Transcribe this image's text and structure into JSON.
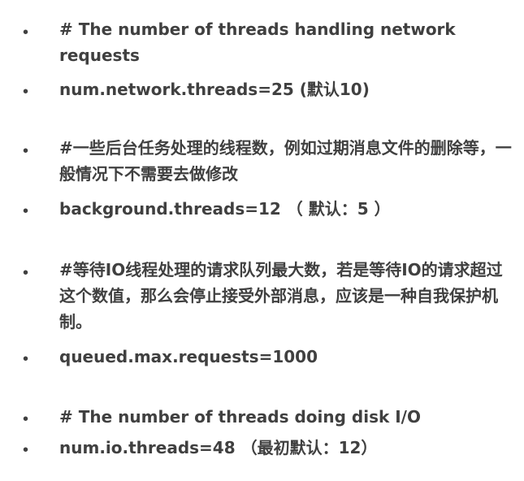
{
  "items": [
    {
      "bullet": "•",
      "text": "# The number of threads handling network requests"
    },
    {
      "bullet": "•",
      "text": "num.network.threads=25 (默认10)"
    },
    {
      "bullet": "•",
      "text": "#一些后台任务处理的线程数，例如过期消息文件的删除等，一般情况下不需要去做修改"
    },
    {
      "bullet": "•",
      "text": "background.threads=12 （ 默认：5 ）"
    },
    {
      "bullet": "•",
      "text": "#等待IO线程处理的请求队列最大数，若是等待IO的请求超过这个数值，那么会停止接受外部消息，应该是一种自我保护机制。"
    },
    {
      "bullet": "•",
      "text": "queued.max.requests=1000"
    },
    {
      "bullet": "•",
      "text": "# The number of threads doing disk I/O"
    },
    {
      "bullet": "•",
      "text": "num.io.threads=48 （最初默认：12）"
    }
  ]
}
